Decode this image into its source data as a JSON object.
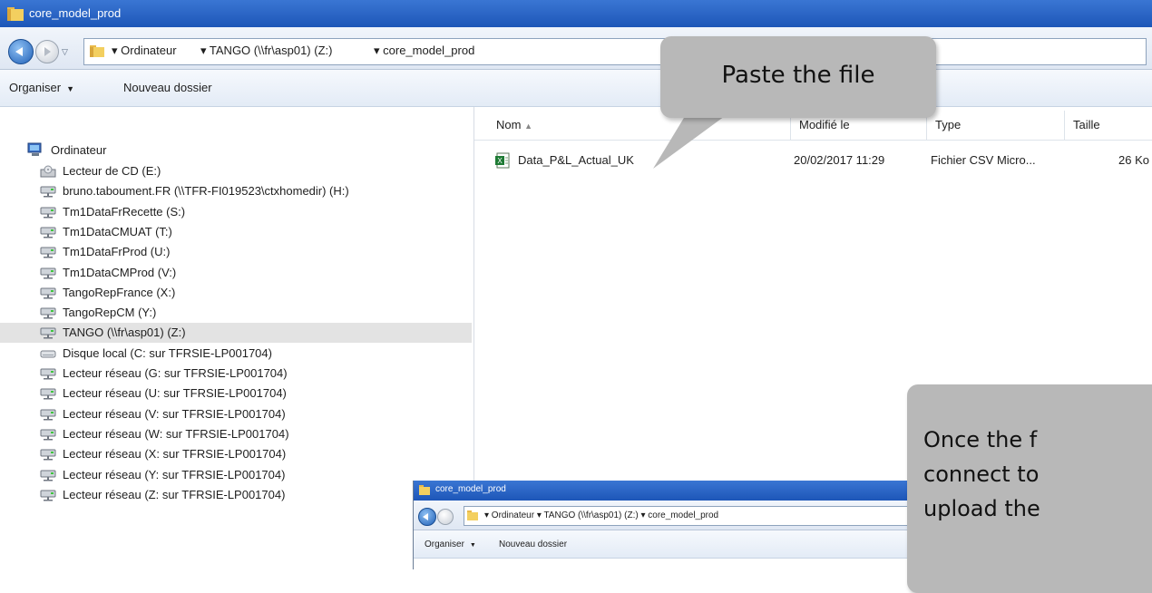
{
  "window": {
    "title": "core_model_prod"
  },
  "address": {
    "crumbs": [
      "▾ Ordinateur",
      "▾ TANGO (\\\\fr\\asp01) (Z:)",
      "▾ core_model_prod"
    ]
  },
  "toolbar": {
    "organize_label": "Organiser",
    "new_folder_label": "Nouveau dossier"
  },
  "nav": {
    "root": "Ordinateur",
    "items": [
      {
        "label": "Lecteur de CD (E:)",
        "icon": "cd-drive-icon"
      },
      {
        "label": "bruno.taboument.FR (\\\\TFR-FI019523\\ctxhomedir) (H:)",
        "icon": "network-drive-icon"
      },
      {
        "label": "Tm1DataFrRecette (S:)",
        "icon": "network-drive-icon"
      },
      {
        "label": "Tm1DataCMUAT (T:)",
        "icon": "network-drive-icon"
      },
      {
        "label": "Tm1DataFrProd (U:)",
        "icon": "network-drive-icon"
      },
      {
        "label": "Tm1DataCMProd (V:)",
        "icon": "network-drive-icon"
      },
      {
        "label": "TangoRepFrance (X:)",
        "icon": "network-drive-icon"
      },
      {
        "label": "TangoRepCM (Y:)",
        "icon": "network-drive-icon"
      },
      {
        "label": "TANGO (\\\\fr\\asp01) (Z:)",
        "icon": "network-drive-icon",
        "selected": true
      },
      {
        "label": "Disque local (C: sur TFRSIE-LP001704)",
        "icon": "local-disk-icon"
      },
      {
        "label": "Lecteur réseau (G: sur TFRSIE-LP001704)",
        "icon": "network-drive-icon"
      },
      {
        "label": "Lecteur réseau (U: sur TFRSIE-LP001704)",
        "icon": "network-drive-icon"
      },
      {
        "label": "Lecteur réseau (V: sur TFRSIE-LP001704)",
        "icon": "network-drive-icon"
      },
      {
        "label": "Lecteur réseau (W: sur TFRSIE-LP001704)",
        "icon": "network-drive-icon"
      },
      {
        "label": "Lecteur réseau (X: sur TFRSIE-LP001704)",
        "icon": "network-drive-icon"
      },
      {
        "label": "Lecteur réseau (Y: sur TFRSIE-LP001704)",
        "icon": "network-drive-icon"
      },
      {
        "label": "Lecteur réseau (Z: sur TFRSIE-LP001704)",
        "icon": "network-drive-icon"
      }
    ]
  },
  "filelist": {
    "columns": {
      "name": "Nom",
      "modified": "Modifié le",
      "type": "Type",
      "size": "Taille"
    },
    "rows": [
      {
        "name": "Data_P&L_Actual_UK",
        "modified": "20/02/2017 11:29",
        "type": "Fichier CSV Micro...",
        "size": "26 Ko"
      }
    ]
  },
  "callouts": {
    "paste": "Paste the file",
    "once_lines": [
      "Once the f",
      "connect to",
      "upload the"
    ]
  },
  "mini_window": {
    "title": "core_model_prod",
    "crumbs": "▾ Ordinateur ▾ TANGO (\\\\fr\\asp01) (Z:) ▾ core_model_prod",
    "organize_label": "Organiser",
    "new_folder_label": "Nouveau dossier"
  }
}
